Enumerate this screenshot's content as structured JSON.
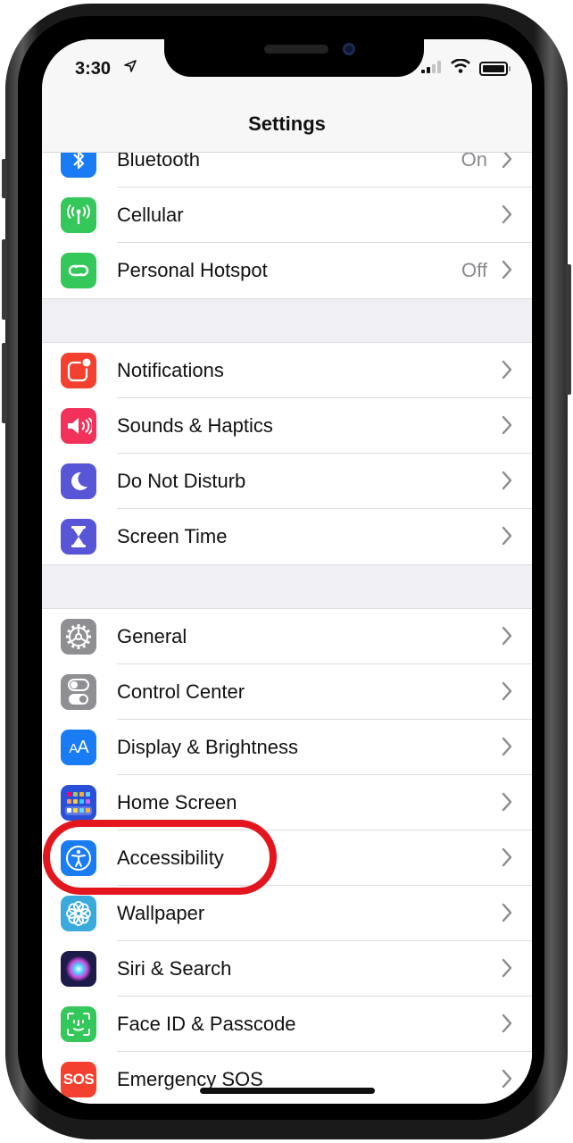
{
  "status_bar": {
    "time": "3:30",
    "location_icon": "location-arrow-icon",
    "signal_icon": "cellular-signal-icon",
    "wifi_icon": "wifi-icon",
    "battery_icon": "battery-icon"
  },
  "nav": {
    "title": "Settings"
  },
  "groups": [
    {
      "items": [
        {
          "id": "bluetooth",
          "label": "Bluetooth",
          "value": "On",
          "icon": "bluetooth-icon",
          "color": "#1a7cf5"
        },
        {
          "id": "cellular",
          "label": "Cellular",
          "value": "",
          "icon": "antenna-icon",
          "color": "#34c759"
        },
        {
          "id": "hotspot",
          "label": "Personal Hotspot",
          "value": "Off",
          "icon": "hotspot-link-icon",
          "color": "#34c759"
        }
      ]
    },
    {
      "items": [
        {
          "id": "notifications",
          "label": "Notifications",
          "value": "",
          "icon": "notification-badge-icon",
          "color": "#f4412f"
        },
        {
          "id": "sounds",
          "label": "Sounds & Haptics",
          "value": "",
          "icon": "speaker-icon",
          "color": "#f2325a"
        },
        {
          "id": "dnd",
          "label": "Do Not Disturb",
          "value": "",
          "icon": "moon-icon",
          "color": "#5856d6"
        },
        {
          "id": "screentime",
          "label": "Screen Time",
          "value": "",
          "icon": "hourglass-icon",
          "color": "#5856d6"
        }
      ]
    },
    {
      "items": [
        {
          "id": "general",
          "label": "General",
          "value": "",
          "icon": "gear-icon",
          "color": "#8e8e93"
        },
        {
          "id": "control",
          "label": "Control Center",
          "value": "",
          "icon": "toggle-icon",
          "color": "#8e8e93"
        },
        {
          "id": "display",
          "label": "Display & Brightness",
          "value": "",
          "icon": "text-size-icon",
          "color": "#1a7cf5"
        },
        {
          "id": "home",
          "label": "Home Screen",
          "value": "",
          "icon": "app-grid-icon",
          "color": "#2a4fd8"
        },
        {
          "id": "accessibility",
          "label": "Accessibility",
          "value": "",
          "icon": "accessibility-icon",
          "color": "#1a7cf5"
        },
        {
          "id": "wallpaper",
          "label": "Wallpaper",
          "value": "",
          "icon": "flower-icon",
          "color": "#3aa9dc"
        },
        {
          "id": "siri",
          "label": "Siri & Search",
          "value": "",
          "icon": "siri-icon",
          "color": "#1d1b4a"
        },
        {
          "id": "faceid",
          "label": "Face ID & Passcode",
          "value": "",
          "icon": "face-id-icon",
          "color": "#34c759"
        },
        {
          "id": "sos",
          "label": "Emergency SOS",
          "value": "",
          "icon": "sos-icon",
          "color": "#f4412f",
          "icon_text": "SOS"
        }
      ]
    }
  ],
  "annotation": {
    "highlight_color": "#e3161e",
    "highlighted_item": "Accessibility"
  }
}
